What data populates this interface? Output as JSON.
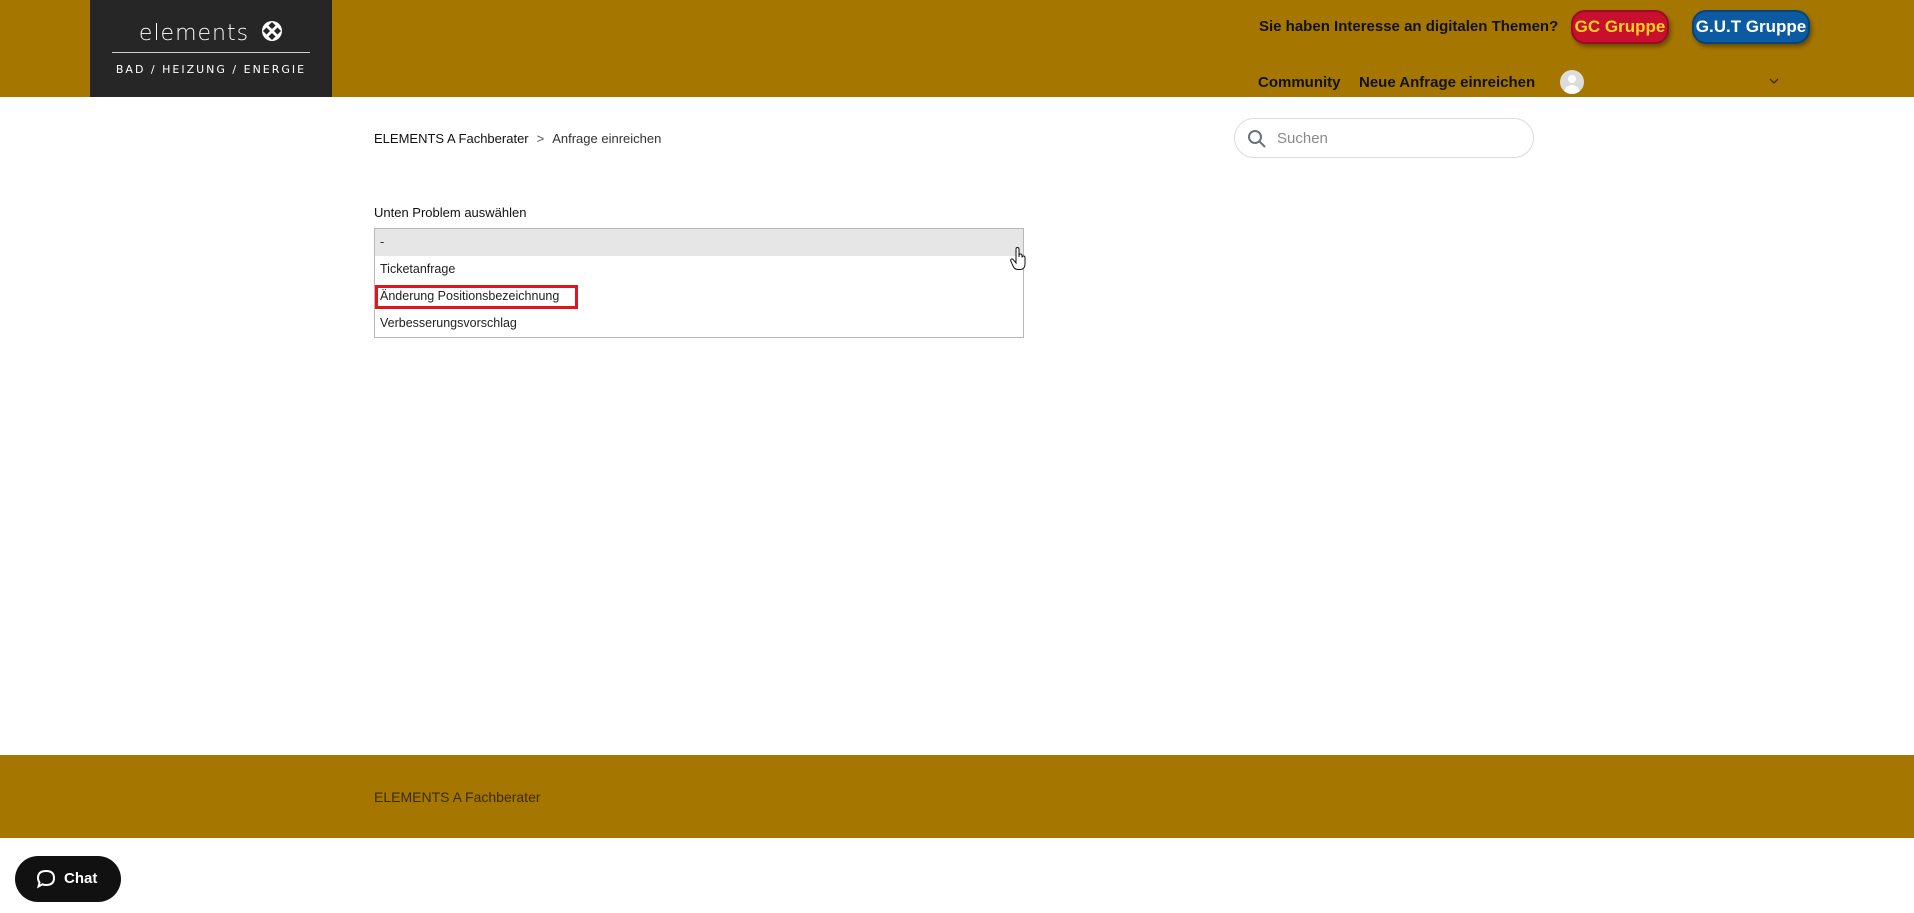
{
  "header": {
    "logo_word": "elements",
    "logo_tagline": "BAD / HEIZUNG / ENERGIE",
    "interest_text": "Sie haben Interesse an digitalen Themen?",
    "gc_button": "GC Gruppe",
    "gut_button": "G.U.T Gruppe",
    "nav": {
      "community": "Community",
      "new_request": "Neue Anfrage einreichen"
    }
  },
  "breadcrumb": {
    "home": "ELEMENTS A Fachberater",
    "separator": ">",
    "current": "Anfrage einreichen"
  },
  "search": {
    "placeholder": "Suchen"
  },
  "form": {
    "label": "Unten Problem auswählen",
    "options": [
      "-",
      "Ticketanfrage",
      "Änderung Positionsbezeichnung",
      "Verbesserungsvorschlag"
    ]
  },
  "footer": {
    "text": "ELEMENTS A Fachberater"
  },
  "chat": {
    "label": "Chat"
  },
  "colors": {
    "brand_gold": "#a67700",
    "logo_bg": "#262626",
    "gc_red": "#c8102e",
    "gc_text": "#ffd21f",
    "gut_blue": "#0b5aa2",
    "highlight_red": "#e0161d"
  },
  "icons": {
    "logo_mark": "four-diamond-cross-icon",
    "search": "search-icon",
    "avatar": "user-avatar-icon",
    "chevron": "chevron-down-icon",
    "chat": "chat-bubble-icon",
    "cursor": "hand-pointer-icon"
  }
}
